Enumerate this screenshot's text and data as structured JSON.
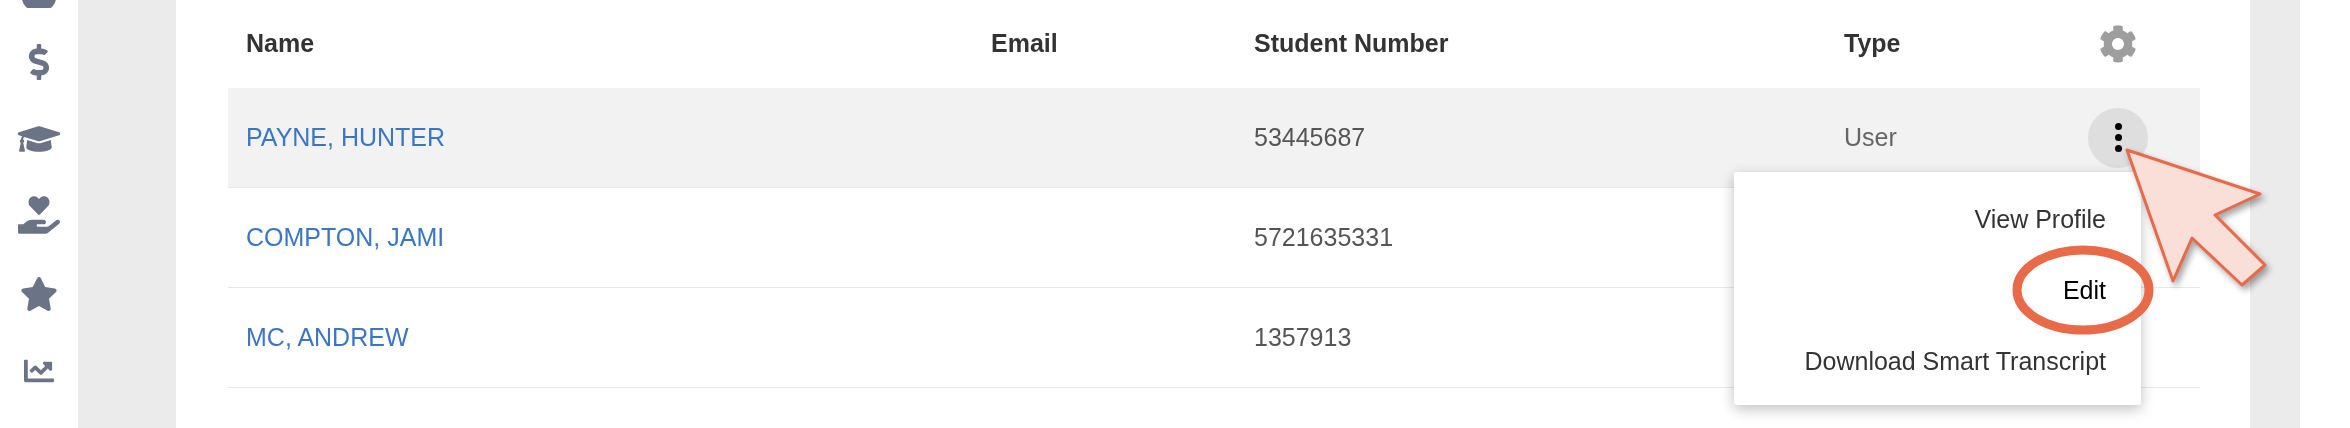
{
  "table": {
    "columns": [
      "Name",
      "Email",
      "Student Number",
      "Type"
    ],
    "rows": [
      {
        "name": "PAYNE, HUNTER",
        "student_number": "53445687",
        "type": "User",
        "selected": true
      },
      {
        "name": "COMPTON, JAMI",
        "student_number": "5721635331",
        "selected": false
      },
      {
        "name": "MC, ANDREW",
        "student_number": "1357913",
        "selected": false
      }
    ]
  },
  "row_menu": {
    "items": [
      {
        "label": "View Profile",
        "circled": false
      },
      {
        "label": "Edit",
        "circled": true
      },
      {
        "label": "Download Smart Transcript",
        "circled": false
      }
    ]
  }
}
